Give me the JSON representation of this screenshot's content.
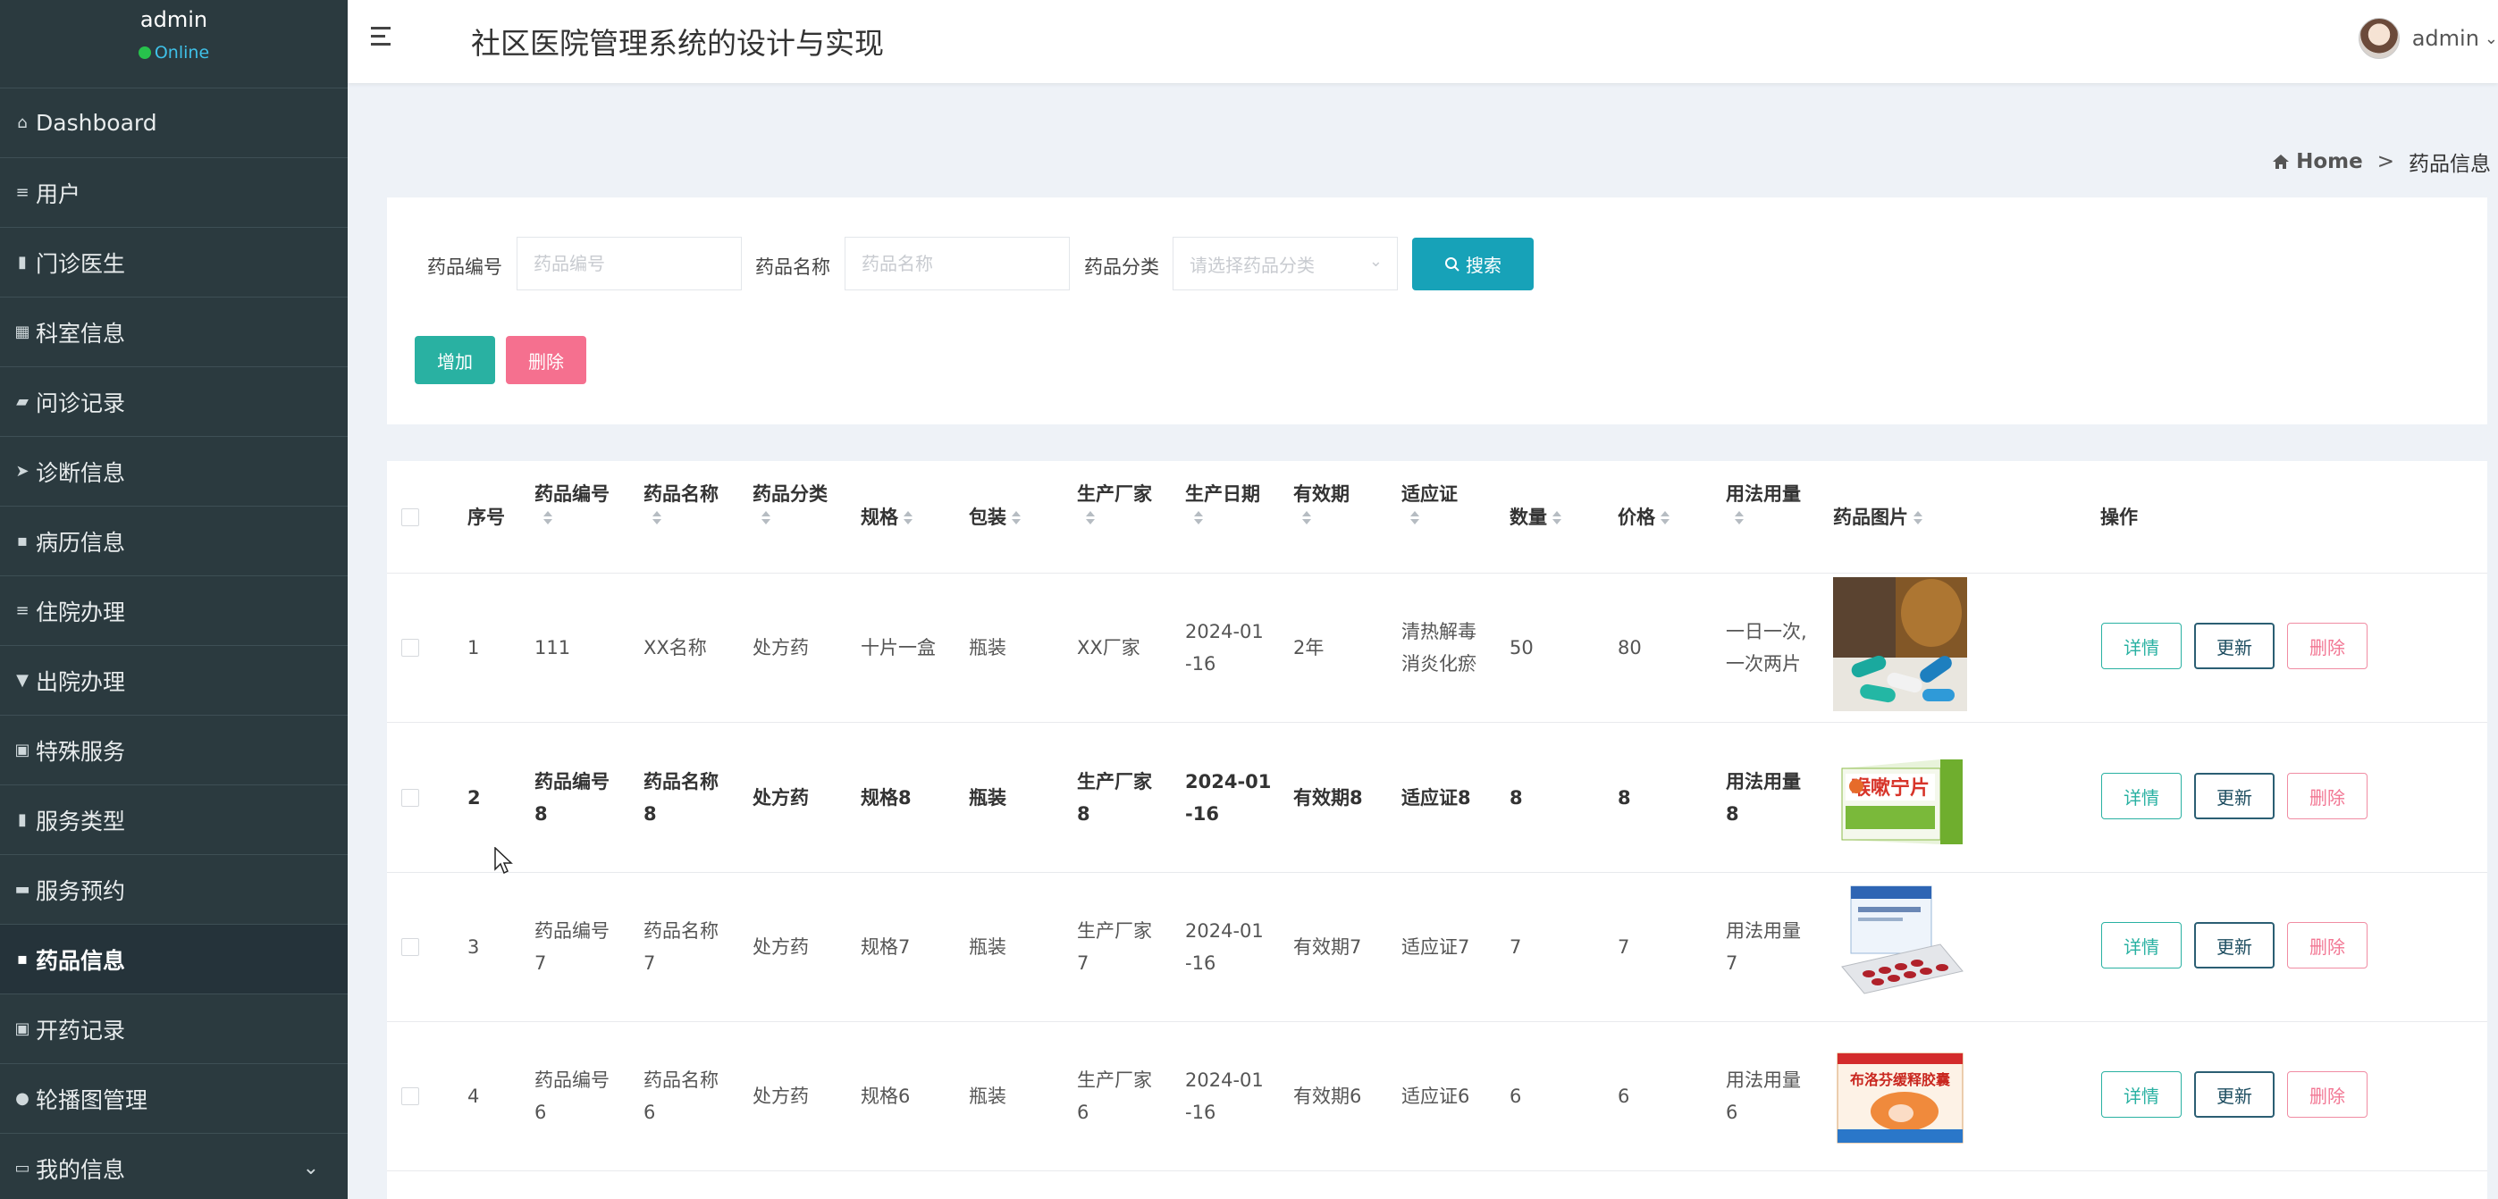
{
  "sidebar": {
    "username": "admin",
    "status": "Online",
    "items": [
      {
        "label": "Dashboard",
        "icon": "home-icon"
      },
      {
        "label": "用户",
        "icon": "sliders-icon"
      },
      {
        "label": "门诊医生",
        "icon": "book-icon"
      },
      {
        "label": "科室信息",
        "icon": "grid-icon"
      },
      {
        "label": "问诊记录",
        "icon": "car-icon"
      },
      {
        "label": "诊断信息",
        "icon": "send-icon"
      },
      {
        "label": "病历信息",
        "icon": "apps-icon"
      },
      {
        "label": "住院办理",
        "icon": "list-icon"
      },
      {
        "label": "出院办理",
        "icon": "badge-icon"
      },
      {
        "label": "特殊服务",
        "icon": "lock-icon"
      },
      {
        "label": "服务类型",
        "icon": "bar-chart-icon"
      },
      {
        "label": "服务预约",
        "icon": "chat-icon"
      },
      {
        "label": "药品信息",
        "icon": "apps-icon"
      },
      {
        "label": "开药记录",
        "icon": "doc-icon"
      },
      {
        "label": "轮播图管理",
        "icon": "user-icon"
      },
      {
        "label": "我的信息",
        "icon": "card-icon"
      }
    ],
    "active_index": 12
  },
  "header": {
    "title": "社区医院管理系统的设计与实现",
    "user": "admin"
  },
  "breadcrumb": {
    "home": "Home",
    "separator": ">",
    "current": "药品信息"
  },
  "search": {
    "code_label": "药品编号",
    "code_placeholder": "药品编号",
    "name_label": "药品名称",
    "name_placeholder": "药品名称",
    "category_label": "药品分类",
    "category_placeholder": "请选择药品分类",
    "search_button": "搜索",
    "add_button": "增加",
    "delete_button": "删除"
  },
  "table": {
    "columns": [
      "序号",
      "药品编号",
      "药品名称",
      "药品分类",
      "规格",
      "包装",
      "生产厂家",
      "生产日期",
      "有效期",
      "适应证",
      "数量",
      "价格",
      "用法用量",
      "药品图片",
      "操作"
    ],
    "actions": {
      "detail": "详情",
      "update": "更新",
      "delete": "删除"
    },
    "rows": [
      {
        "index": "1",
        "code": [
          "111"
        ],
        "name": [
          "XX名称"
        ],
        "category": "处方药",
        "spec": "十片一盒",
        "package": "瓶装",
        "maker": [
          "XX厂家"
        ],
        "date": [
          "2024-01",
          "-16"
        ],
        "validity": "2年",
        "indication": [
          "清热解毒",
          "消炎化瘀"
        ],
        "quantity": "50",
        "price": "80",
        "usage": [
          "一日一次,",
          "一次两片"
        ],
        "image": "pills-bottle"
      },
      {
        "index": "2",
        "code": [
          "药品编号",
          "8"
        ],
        "name": [
          "药品名称",
          "8"
        ],
        "category": "处方药",
        "spec": "规格8",
        "package": "瓶装",
        "maker": [
          "生产厂家",
          "8"
        ],
        "date": [
          "2024-01",
          "-16"
        ],
        "validity": "有效期8",
        "indication": [
          "适应证8"
        ],
        "quantity": "8",
        "price": "8",
        "usage": [
          "用法用量",
          "8"
        ],
        "image": "green-box",
        "box_text": "喉嗽宁片"
      },
      {
        "index": "3",
        "code": [
          "药品编号",
          "7"
        ],
        "name": [
          "药品名称",
          "7"
        ],
        "category": "处方药",
        "spec": "规格7",
        "package": "瓶装",
        "maker": [
          "生产厂家",
          "7"
        ],
        "date": [
          "2024-01",
          "-16"
        ],
        "validity": "有效期7",
        "indication": [
          "适应证7"
        ],
        "quantity": "7",
        "price": "7",
        "usage": [
          "用法用量",
          "7"
        ],
        "image": "blister-box"
      },
      {
        "index": "4",
        "code": [
          "药品编号",
          "6"
        ],
        "name": [
          "药品名称",
          "6"
        ],
        "category": "处方药",
        "spec": "规格6",
        "package": "瓶装",
        "maker": [
          "生产厂家",
          "6"
        ],
        "date": [
          "2024-01",
          "-16"
        ],
        "validity": "有效期6",
        "indication": [
          "适应证6"
        ],
        "quantity": "6",
        "price": "6",
        "usage": [
          "用法用量",
          "6"
        ],
        "image": "orange-box",
        "box_text": "布洛芬缓释胶囊"
      }
    ]
  },
  "colors": {
    "sidebar_bg": "#2b3a3f",
    "teal": "#29b1a2",
    "search_blue": "#17a2b8",
    "pink": "#f5708f"
  }
}
